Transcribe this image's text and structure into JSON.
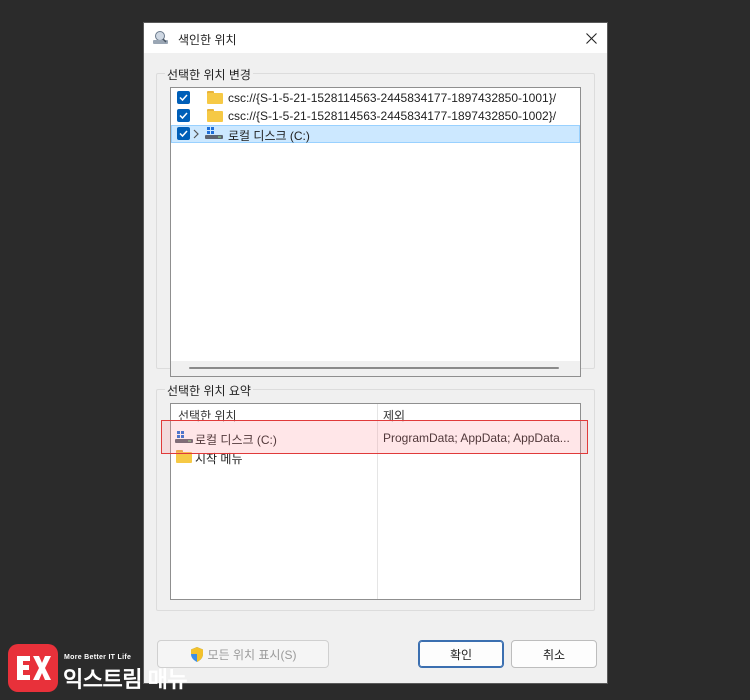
{
  "window": {
    "title": "색인한 위치",
    "close_glyph": "✕"
  },
  "change_section": {
    "label": "선택한 위치 변경",
    "items": [
      {
        "text": "csc://{S-1-5-21-1528114563-2445834177-1897432850-1001}/",
        "checked": true,
        "icon": "folder-icon",
        "expandable": false
      },
      {
        "text": "csc://{S-1-5-21-1528114563-2445834177-1897432850-1002}/",
        "checked": true,
        "icon": "folder-icon",
        "expandable": false
      },
      {
        "text": "로컬 디스크 (C:)",
        "checked": true,
        "icon": "drive-icon",
        "expandable": true,
        "selected": true
      }
    ]
  },
  "summary_section": {
    "label": "선택한 위치 요약",
    "columns": [
      "선택한 위치",
      "제외"
    ],
    "rows": [
      {
        "location": "로컬 디스크 (C:)",
        "exclude": "ProgramData; AppData; AppData...",
        "icon": "drive-icon"
      },
      {
        "location": "시작 메뉴",
        "exclude": "",
        "icon": "folder-icon"
      }
    ]
  },
  "buttons": {
    "show_all": "모든 위치 표시(S)",
    "ok": "확인",
    "cancel": "취소"
  },
  "watermark": {
    "tagline": "More Better IT Life",
    "name": "익스트림 매뉴얼"
  },
  "colors": {
    "checkbox": "#005fb8",
    "selection": "#cce8ff",
    "highlight_border": "#e03a3a",
    "logo": "#e8313a"
  }
}
